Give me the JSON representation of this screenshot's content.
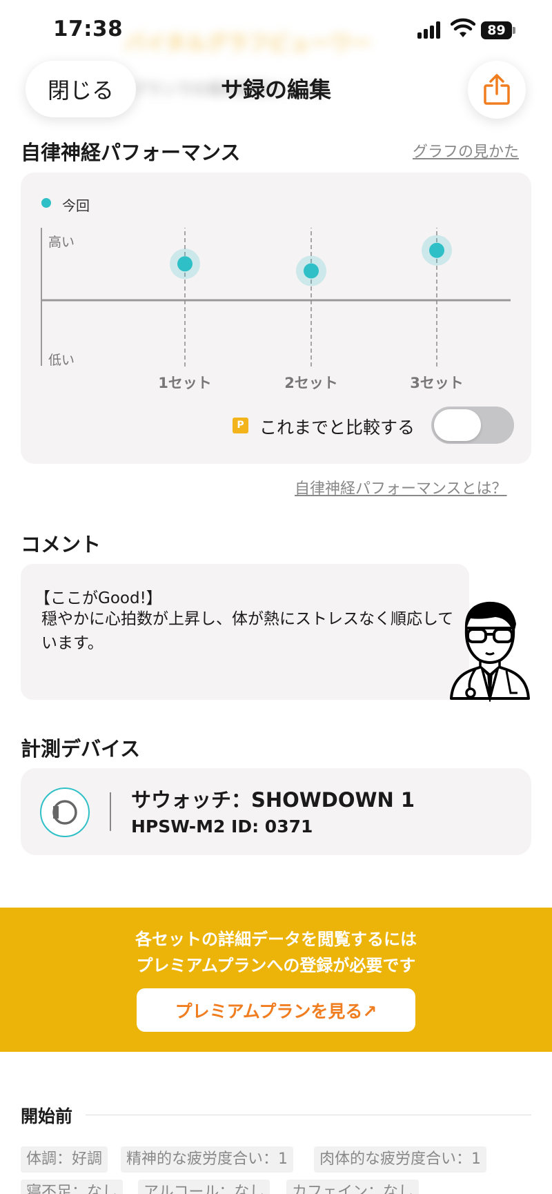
{
  "status_bar": {
    "time": "17:38",
    "battery": "89"
  },
  "background_header": {
    "title": "バイタルグラフビューワー",
    "subtitle": "プランでの保存期限は 30日"
  },
  "header": {
    "close_label": "閉じる",
    "title": "サ録の編集",
    "share_icon": "share-icon"
  },
  "performance": {
    "title": "自律神経パフォーマンス",
    "guide_link": "グラフの見かた",
    "about_link": "自律神経パフォーマンスとは？",
    "compare_badge": "P",
    "compare_label": "これまでと比較する",
    "compare_enabled": false
  },
  "chart_data": {
    "type": "scatter",
    "categories": [
      "1セット",
      "2セット",
      "3セット"
    ],
    "series": [
      {
        "name": "今回",
        "values": [
          0.62,
          0.5,
          0.85
        ]
      }
    ],
    "ylabel_high": "高い",
    "ylabel_low": "低い",
    "ylim": [
      -1,
      1
    ],
    "point_color": "#2ec0c6"
  },
  "comment": {
    "title": "コメント",
    "heading": "【ここがGood!】",
    "body": "穏やかに心拍数が上昇し、体が熱にストレスなく順応しています。"
  },
  "device": {
    "title": "計測デバイス",
    "name": "サウォッチ：SHOWDOWN 1",
    "model": "HPSW-M2  ID: 0371"
  },
  "premium": {
    "line1": "各セットの詳細データを閲覧するには",
    "line2": "プレミアムプランへの登録が必要です",
    "button": "プレミアムプランを見る↗"
  },
  "before_start": {
    "title": "開始前",
    "tags": [
      "体調：好調",
      "精神的な疲労度合い：1",
      "肉体的な疲労度合い：1",
      "寝不足：なし",
      "アルコール：なし",
      "カフェイン：なし"
    ]
  }
}
